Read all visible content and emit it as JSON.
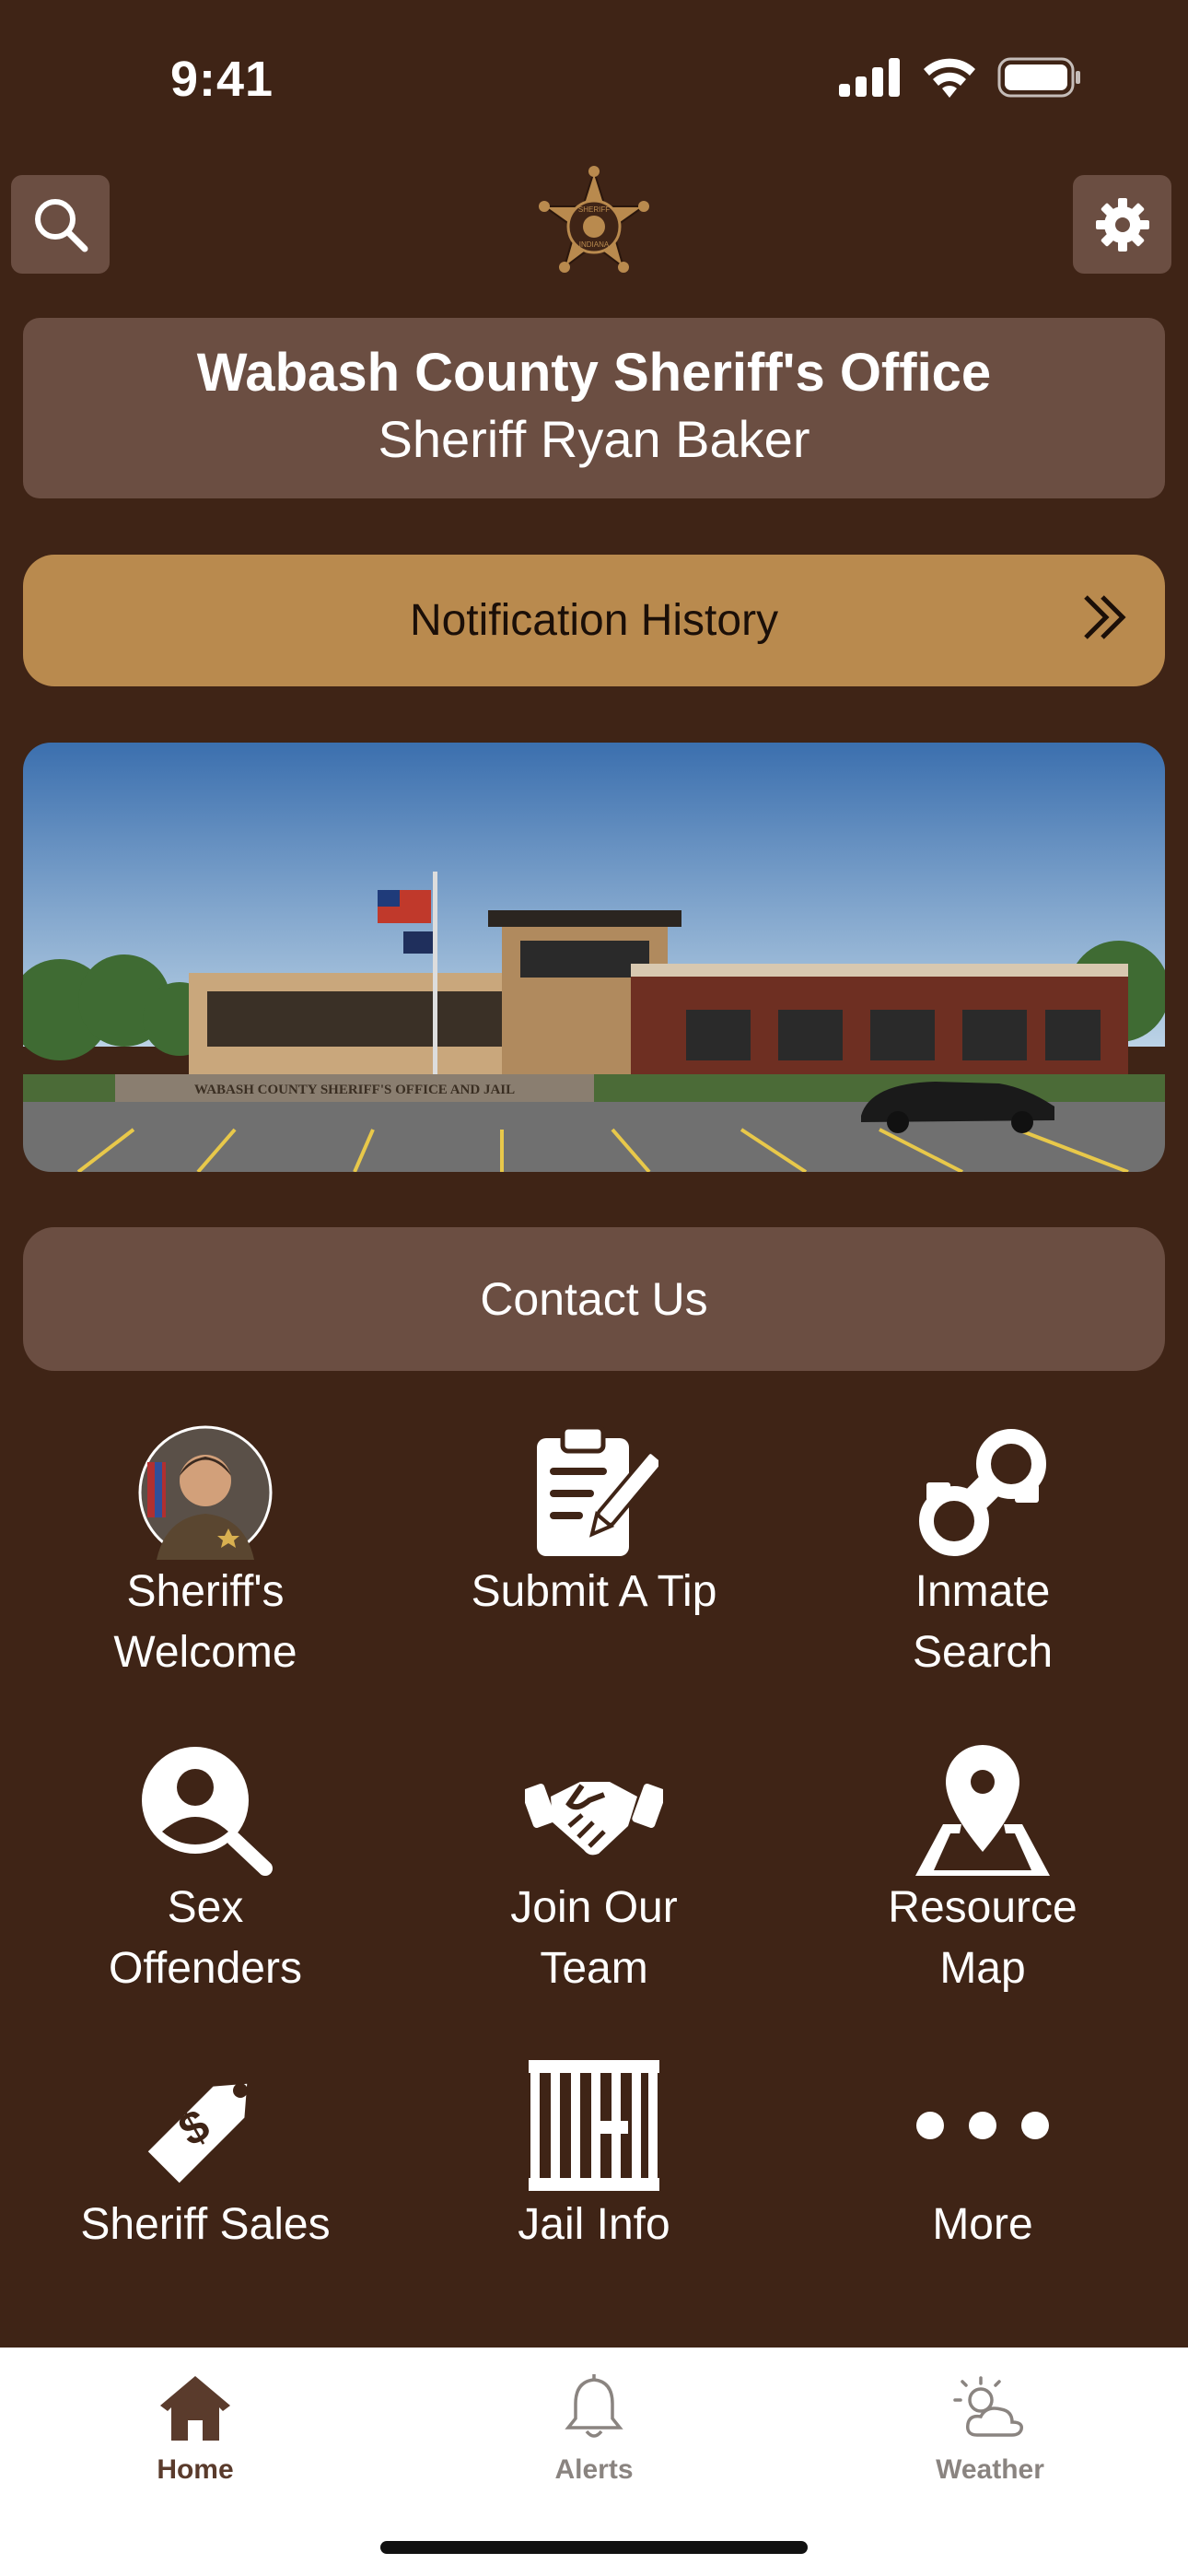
{
  "status": {
    "time": "9:41"
  },
  "header": {
    "org_name": "Wabash County Sheriff's Office",
    "sheriff_name": "Sheriff Ryan Baker",
    "badge_text_top": "SHERIFF",
    "badge_text_bottom": "INDIANA"
  },
  "notification": {
    "label": "Notification History"
  },
  "hero": {
    "sign_text": "WABASH COUNTY SHERIFF'S OFFICE AND JAIL"
  },
  "contact": {
    "label": "Contact Us"
  },
  "tiles": [
    {
      "line1": "Sheriff's",
      "line2": "Welcome",
      "icon": "sheriff-portrait"
    },
    {
      "line1": "Submit A Tip",
      "line2": "",
      "icon": "clipboard-pen-icon"
    },
    {
      "line1": "Inmate",
      "line2": "Search",
      "icon": "handcuffs-icon"
    },
    {
      "line1": "Sex",
      "line2": "Offenders",
      "icon": "person-search-icon"
    },
    {
      "line1": "Join Our",
      "line2": "Team",
      "icon": "handshake-icon"
    },
    {
      "line1": "Resource",
      "line2": "Map",
      "icon": "map-pin-icon"
    },
    {
      "line1": "Sheriff Sales",
      "line2": "",
      "icon": "price-tag-icon"
    },
    {
      "line1": "Jail Info",
      "line2": "",
      "icon": "jail-bars-icon"
    },
    {
      "line1": "More",
      "line2": "",
      "icon": "more-dots-icon"
    }
  ],
  "tabbar": {
    "tabs": [
      {
        "label": "Home",
        "icon": "home-icon",
        "active": true
      },
      {
        "label": "Alerts",
        "icon": "bell-icon",
        "active": false
      },
      {
        "label": "Weather",
        "icon": "weather-icon",
        "active": false
      }
    ]
  },
  "colors": {
    "background": "#3f2416",
    "card": "#6b4e42",
    "accent": "#b98a4e",
    "tab_active": "#5a3b2c"
  }
}
